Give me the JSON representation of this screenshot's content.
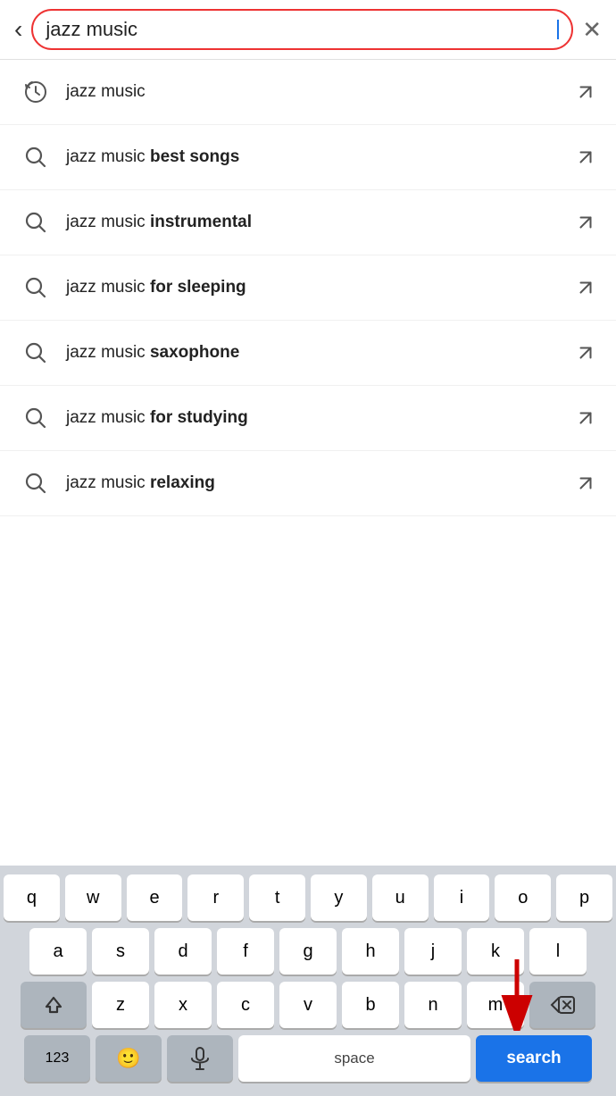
{
  "searchBar": {
    "inputValue": "jazz music",
    "closeLabel": "×",
    "backLabel": "‹"
  },
  "suggestions": [
    {
      "id": 1,
      "type": "history",
      "prefix": "jazz music",
      "bold": "",
      "full": "jazz music"
    },
    {
      "id": 2,
      "type": "search",
      "prefix": "jazz music ",
      "bold": "best songs",
      "full": "jazz music best songs"
    },
    {
      "id": 3,
      "type": "search",
      "prefix": "jazz music ",
      "bold": "instrumental",
      "full": "jazz music instrumental"
    },
    {
      "id": 4,
      "type": "search",
      "prefix": "jazz music ",
      "bold": "for sleeping",
      "full": "jazz music for sleeping"
    },
    {
      "id": 5,
      "type": "search",
      "prefix": "jazz music ",
      "bold": "saxophone",
      "full": "jazz music saxophone"
    },
    {
      "id": 6,
      "type": "search",
      "prefix": "jazz music ",
      "bold": "for studying",
      "full": "jazz music for studying"
    },
    {
      "id": 7,
      "type": "search",
      "prefix": "jazz music ",
      "bold": "relaxing",
      "full": "jazz music relaxing"
    }
  ],
  "keyboard": {
    "rows": [
      [
        "q",
        "w",
        "e",
        "r",
        "t",
        "y",
        "u",
        "i",
        "o",
        "p"
      ],
      [
        "a",
        "s",
        "d",
        "f",
        "g",
        "h",
        "j",
        "k",
        "l"
      ],
      [
        "⇧",
        "z",
        "x",
        "c",
        "v",
        "b",
        "n",
        "m",
        "⌫"
      ],
      [
        "123",
        "😊",
        "🎤",
        "space",
        "search"
      ]
    ],
    "searchLabel": "search",
    "spaceLabel": "space",
    "numberLabel": "123"
  }
}
